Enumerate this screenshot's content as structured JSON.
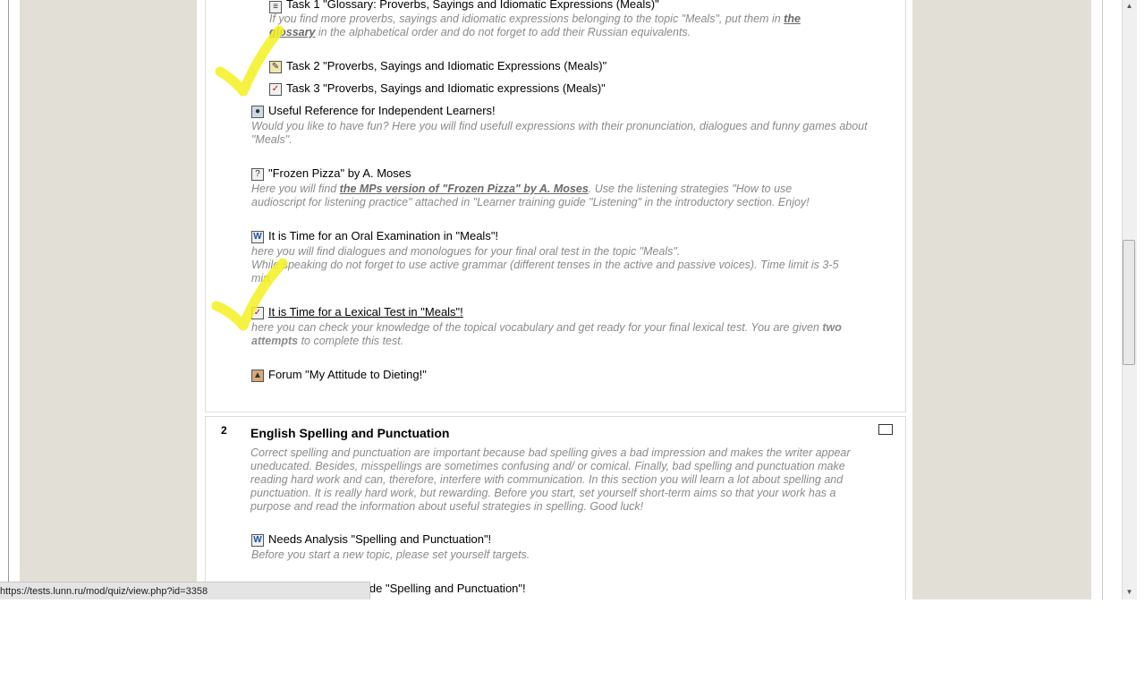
{
  "section1": {
    "task1": {
      "label": "Task 1 \"Glossary: Proverbs, Sayings and Idiomatic Expressions (Meals)\"",
      "icon": "glossary-icon",
      "desc_pre": "If you find more proverbs, sayings and idiomatic expressions belonging to the topic \"Meals\", put them in ",
      "desc_link": "the glossary",
      "desc_post": " in the alphabetical order and do not forget to add their Russian equivalents."
    },
    "task2": {
      "label": "Task 2 \"Proverbs, Sayings and Idiomatic Expressions (Meals)\"",
      "icon": "edit-icon"
    },
    "task3": {
      "label": "Task 3 \"Proverbs, Sayings and Idiomatic expressions (Meals)\"",
      "icon": "quiz-icon"
    },
    "useful": {
      "label": "Useful Reference for Independent Learners!",
      "icon": "globe-icon",
      "desc": "Would you like to have fun? Here you will find usefull expressions with their pronunciation, dialogues and funny games about \"Meals\"."
    },
    "pizza": {
      "label": "\"Frozen Pizza\" by A. Moses",
      "icon": "question-icon",
      "desc_pre": "Here you will find ",
      "desc_link": "the MPs version of \"Frozen Pizza\" by A. Moses",
      "desc_post": ". Use the listening strategies \"How to use audioscript for listening practice\" attached in \"Learner training guide \"Listening\" in the introductory section. Enjoy!"
    },
    "oral": {
      "label": "It is Time for an Oral Examination in \"Meals\"!",
      "icon": "word-doc-icon",
      "desc1": "here you will find dialogues and monologues for your final oral test in the topic \"Meals\".",
      "desc2": "While speaking do not forget to use active grammar (different tenses in the active and passive voices). Time limit is 3-5 min."
    },
    "lexical": {
      "label": "It is Time for a Lexical Test in \"Meals\"!",
      "icon": "quiz-icon",
      "desc_pre": "here you can check your knowledge of the topical vocabulary and get ready for your final lexical test. You are given ",
      "desc_bold": "two attempts",
      "desc_post": " to complete this test."
    },
    "forum": {
      "label": "Forum \"My Attitude to Dieting!\"",
      "icon": "forum-icon"
    }
  },
  "section2": {
    "number": "2",
    "title": "English Spelling and Punctuation",
    "desc": "Correct spelling and punctuation are important because bad spelling gives a bad impression and makes the writer appear uneducated. Besides, misspellings are sometimes confusing and/ or comical. Finally, bad spelling and punctuation make reading hard work and can, therefore, interfere with communication. In this section you will learn a lot about spelling and punctuation. It is really hard work, but rewarding. Before you start, set yourself short-term aims so that your work has a purpose and read the information about useful strategies in spelling. Good luck!",
    "needs": {
      "label": "Needs Analysis \"Spelling and Punctuation\"!",
      "icon": "word-doc-icon",
      "desc": "Before you start a new topic, please set yourself targets."
    },
    "guide": {
      "label": "ide \"Spelling and Punctuation\"!"
    }
  },
  "status_url": "https://tests.lunn.ru/mod/quiz/view.php?id=3358",
  "colors": {
    "sidebar": "#e2dfd6",
    "description": "#8a8a8a",
    "highlight_check": "#f5f020"
  }
}
